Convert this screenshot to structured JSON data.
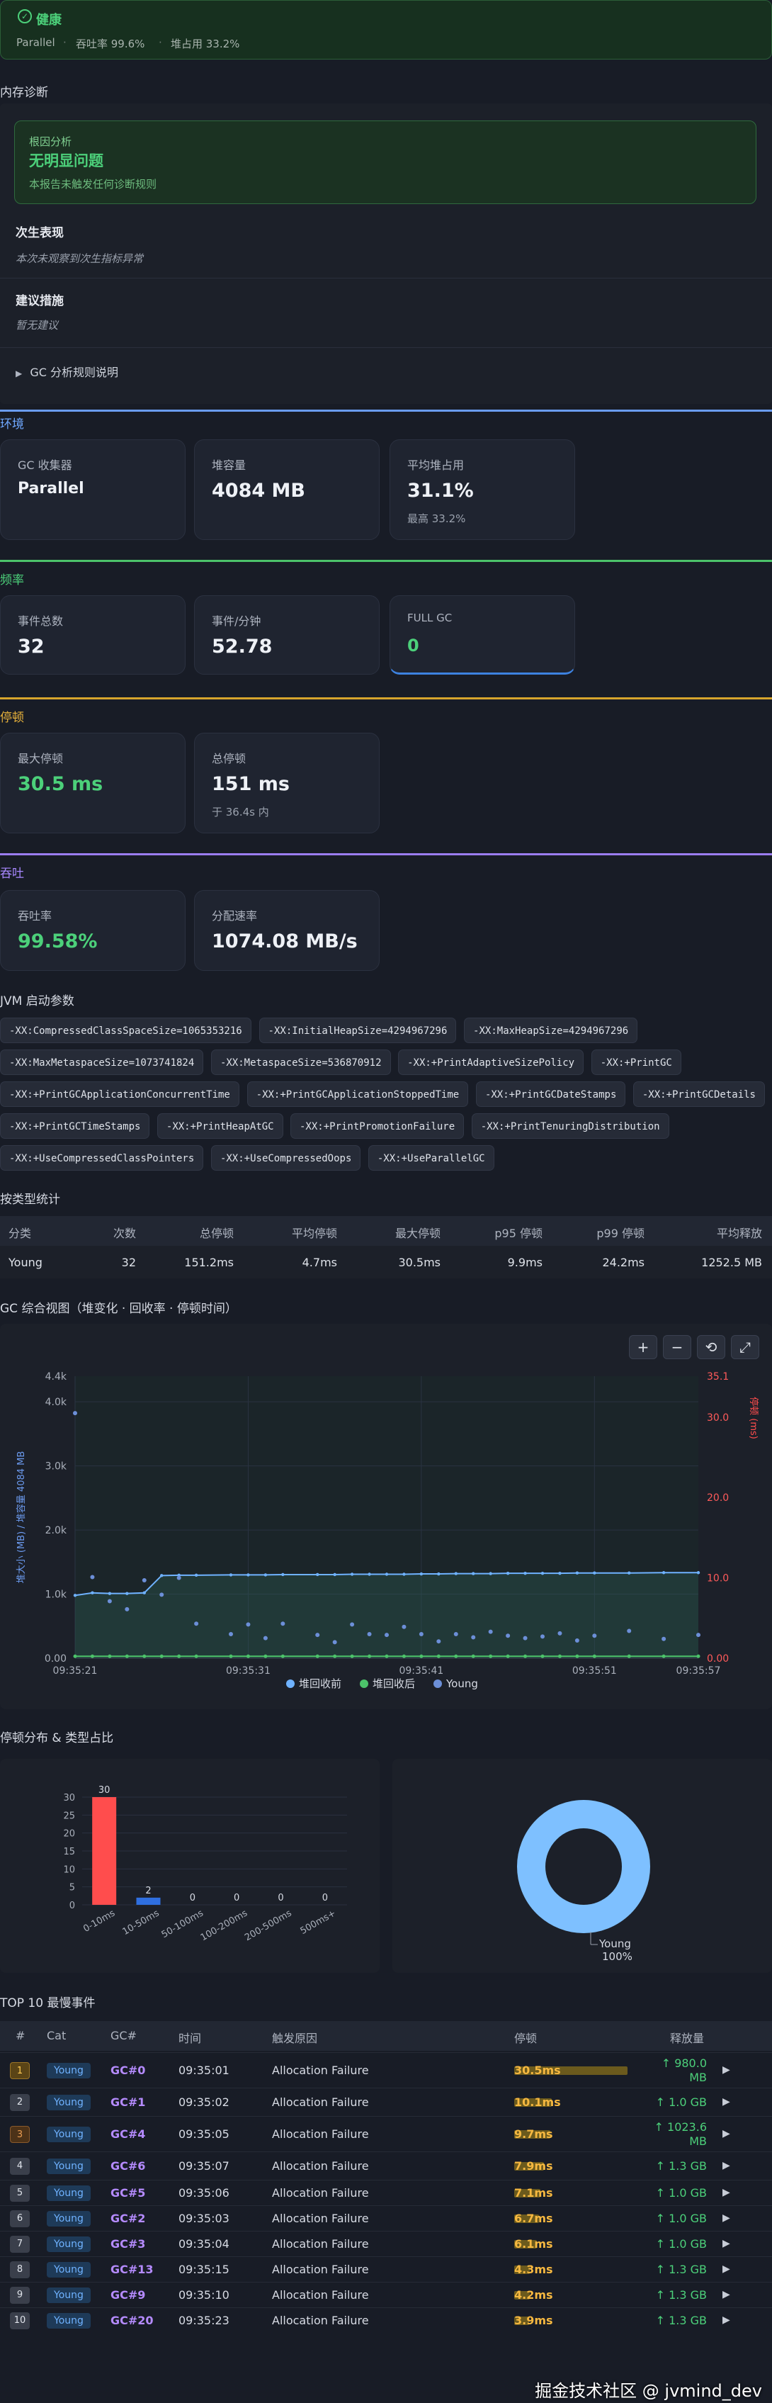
{
  "health": {
    "icon": "check-circle-icon",
    "title": "健康",
    "collector": "Parallel",
    "sep1": "·",
    "throughput": "吞吐率 99.6%",
    "sep2": "·",
    "heap": "堆占用 33.2%"
  },
  "memory_diag": {
    "title": "内存诊断",
    "root_cause_label": "根因分析",
    "root_cause_value": "无明显问题",
    "root_cause_desc": "本报告未触发任何诊断规则",
    "young_title": "次生表现",
    "young_desc": "本次未观察到次生指标异常",
    "advice_title": "建议措施",
    "advice_desc": "暂无建议",
    "rules_toggle": "GC 分析规则说明"
  },
  "environment": {
    "title": "环境",
    "cards": [
      {
        "label": "GC 收集器",
        "value": "Parallel"
      },
      {
        "label": "堆容量",
        "value": "4084 MB"
      },
      {
        "label": "平均堆占用",
        "value": "31.1%",
        "sub": "最高 33.2%"
      }
    ]
  },
  "frequency": {
    "title": "频率",
    "cards": [
      {
        "label": "事件总数",
        "value": "32"
      },
      {
        "label": "事件/分钟",
        "value": "52.78"
      },
      {
        "label": "FULL GC",
        "value": "0"
      }
    ]
  },
  "pause": {
    "title": "停顿",
    "cards": [
      {
        "label": "最大停顿",
        "value": "30.5 ms"
      },
      {
        "label": "总停顿",
        "value": "151 ms",
        "sub": "于 36.4s 内"
      }
    ]
  },
  "throughput_sec": {
    "title": "吞吐",
    "cards": [
      {
        "label": "吞吐率",
        "value": "99.58%"
      },
      {
        "label": "分配速率",
        "value": "1074.08 MB/s"
      }
    ]
  },
  "jvm": {
    "title": "JVM 启动参数",
    "flags": [
      "-XX:CompressedClassSpaceSize=1065353216",
      "-XX:InitialHeapSize=4294967296",
      "-XX:MaxHeapSize=4294967296",
      "-XX:MaxMetaspaceSize=1073741824",
      "-XX:MetaspaceSize=536870912",
      "-XX:+PrintAdaptiveSizePolicy",
      "-XX:+PrintGC",
      "-XX:+PrintGCApplicationConcurrentTime",
      "-XX:+PrintGCApplicationStoppedTime",
      "-XX:+PrintGCDateStamps",
      "-XX:+PrintGCDetails",
      "-XX:+PrintGCTimeStamps",
      "-XX:+PrintHeapAtGC",
      "-XX:+PrintPromotionFailure",
      "-XX:+PrintTenuringDistribution",
      "-XX:+UseCompressedClassPointers",
      "-XX:+UseCompressedOops",
      "-XX:+UseParallelGC"
    ]
  },
  "type_stats": {
    "title": "按类型统计",
    "headers": [
      "分类",
      "次数",
      "总停顿",
      "平均停顿",
      "最大停顿",
      "p95 停顿",
      "p99 停顿",
      "平均释放"
    ],
    "row": [
      "Young",
      "32",
      "151.2ms",
      "4.7ms",
      "30.5ms",
      "9.9ms",
      "24.2ms",
      "1252.5 MB"
    ]
  },
  "overview": {
    "title": "GC 综合视图（堆变化 · 回收率 · 停顿时间）",
    "buttons": [
      "+",
      "−",
      "⟲",
      "⤢"
    ],
    "left_ticks": [
      "4.4k",
      "4.0k",
      "3.0k",
      "2.0k",
      "1.0k",
      "0.00"
    ],
    "right_ticks": [
      "35.1",
      "30.0",
      "20.0",
      "10.0",
      "0.00"
    ],
    "left_axis_label": "堆大小 (MB) / 堆容量 4084 MB",
    "right_axis_label": "停顿 (ms)",
    "x_ticks": [
      "09:35:21",
      "09:35:31",
      "09:35:41",
      "09:35:51",
      "09:35:57"
    ],
    "legend": [
      "堆回收前",
      "堆回收后",
      "Young"
    ],
    "colors": {
      "before": "#6fb2ff",
      "after": "#4cc36a",
      "young": "#6c8fd8",
      "left_axis": "#6c9bf0",
      "right_axis": "#ff4d4d"
    }
  },
  "chart_data": [
    {
      "type": "line",
      "title": "GC 综合视图（堆变化 · 回收率 · 停顿时间）",
      "xlabel": "",
      "ylabel": "堆大小 (MB) / 堆容量 4084 MB",
      "y2label": "停顿 (ms)",
      "ylim": [
        0,
        4400
      ],
      "y2lim": [
        0,
        35.1
      ],
      "x": [
        "09:35:21",
        "09:35:22",
        "09:35:23",
        "09:35:24",
        "09:35:25",
        "09:35:26",
        "09:35:27",
        "09:35:28",
        "09:35:30",
        "09:35:31",
        "09:35:32",
        "09:35:33",
        "09:35:35",
        "09:35:36",
        "09:35:37",
        "09:35:38",
        "09:35:39",
        "09:35:40",
        "09:35:41",
        "09:35:42",
        "09:35:43",
        "09:35:44",
        "09:35:45",
        "09:35:46",
        "09:35:47",
        "09:35:48",
        "09:35:49",
        "09:35:50",
        "09:35:51",
        "09:35:53",
        "09:35:55",
        "09:35:57"
      ],
      "series": [
        {
          "name": "堆回收前",
          "values": [
            980,
            1020,
            1010,
            1010,
            1020,
            1290,
            1295,
            1295,
            1300,
            1300,
            1300,
            1305,
            1305,
            1305,
            1310,
            1310,
            1310,
            1310,
            1315,
            1315,
            1320,
            1320,
            1320,
            1325,
            1325,
            1325,
            1325,
            1330,
            1330,
            1330,
            1335,
            1335
          ]
        },
        {
          "name": "堆回收后",
          "values": [
            30,
            30,
            30,
            30,
            30,
            30,
            30,
            30,
            30,
            30,
            30,
            30,
            30,
            30,
            30,
            30,
            30,
            30,
            30,
            30,
            30,
            30,
            30,
            30,
            30,
            30,
            30,
            30,
            30,
            30,
            30,
            30
          ]
        },
        {
          "name": "Young",
          "values": [
            30.5,
            10.1,
            7.1,
            6.1,
            9.7,
            7.9,
            10.0,
            4.3,
            3.0,
            4.2,
            2.5,
            4.3,
            2.9,
            2.0,
            4.2,
            3.0,
            2.9,
            3.9,
            3.0,
            2.1,
            3.0,
            2.6,
            3.3,
            2.8,
            2.5,
            2.7,
            3.1,
            2.2,
            2.8,
            3.4,
            2.4,
            2.9
          ]
        }
      ]
    },
    {
      "type": "bar",
      "title": "",
      "xlabel": "",
      "ylabel": "",
      "categories": [
        "0-10ms",
        "10-50ms",
        "50-100ms",
        "100-200ms",
        "200-500ms",
        "500ms+"
      ],
      "values": [
        30,
        2,
        0,
        0,
        0,
        0
      ],
      "ylim": [
        0,
        30
      ],
      "yticks": [
        "0",
        "5",
        "10",
        "15",
        "20",
        "25",
        "30"
      ]
    },
    {
      "type": "pie",
      "title": "",
      "categories": [
        "Young"
      ],
      "values": [
        100
      ],
      "labels": [
        "Young",
        "100%"
      ]
    }
  ],
  "dist_title": "停顿分布 & 类型占比",
  "top_events": {
    "title": "TOP 10 最慢事件",
    "headers": [
      "#",
      "Cat",
      "GC#",
      "时间",
      "触发原因",
      "停顿",
      "释放量"
    ],
    "rows": [
      {
        "rank": "1",
        "cat": "Young",
        "gc": "GC#0",
        "time": "09:35:01",
        "cause": "Allocation Failure",
        "pause": "30.5ms",
        "pause_frac": 1.0,
        "release": "↑ 980.0\nMB"
      },
      {
        "rank": "2",
        "cat": "Young",
        "gc": "GC#1",
        "time": "09:35:02",
        "cause": "Allocation Failure",
        "pause": "10.1ms",
        "pause_frac": 0.33,
        "release": "↑ 1.0 GB"
      },
      {
        "rank": "3",
        "cat": "Young",
        "gc": "GC#4",
        "time": "09:35:05",
        "cause": "Allocation Failure",
        "pause": "9.7ms",
        "pause_frac": 0.32,
        "release": "↑ 1023.6\nMB"
      },
      {
        "rank": "4",
        "cat": "Young",
        "gc": "GC#6",
        "time": "09:35:07",
        "cause": "Allocation Failure",
        "pause": "7.9ms",
        "pause_frac": 0.26,
        "release": "↑ 1.3 GB"
      },
      {
        "rank": "5",
        "cat": "Young",
        "gc": "GC#5",
        "time": "09:35:06",
        "cause": "Allocation Failure",
        "pause": "7.1ms",
        "pause_frac": 0.23,
        "release": "↑ 1.0 GB"
      },
      {
        "rank": "6",
        "cat": "Young",
        "gc": "GC#2",
        "time": "09:35:03",
        "cause": "Allocation Failure",
        "pause": "6.7ms",
        "pause_frac": 0.22,
        "release": "↑ 1.0 GB"
      },
      {
        "rank": "7",
        "cat": "Young",
        "gc": "GC#3",
        "time": "09:35:04",
        "cause": "Allocation Failure",
        "pause": "6.1ms",
        "pause_frac": 0.2,
        "release": "↑ 1.0 GB"
      },
      {
        "rank": "8",
        "cat": "Young",
        "gc": "GC#13",
        "time": "09:35:15",
        "cause": "Allocation Failure",
        "pause": "4.3ms",
        "pause_frac": 0.14,
        "release": "↑ 1.3 GB"
      },
      {
        "rank": "9",
        "cat": "Young",
        "gc": "GC#9",
        "time": "09:35:10",
        "cause": "Allocation Failure",
        "pause": "4.2ms",
        "pause_frac": 0.14,
        "release": "↑ 1.3 GB"
      },
      {
        "rank": "10",
        "cat": "Young",
        "gc": "GC#20",
        "time": "09:35:23",
        "cause": "Allocation Failure",
        "pause": "3.9ms",
        "pause_frac": 0.13,
        "release": "↑ 1.3 GB"
      }
    ]
  },
  "watermark": "掘金技术社区 @ jvmind_dev"
}
